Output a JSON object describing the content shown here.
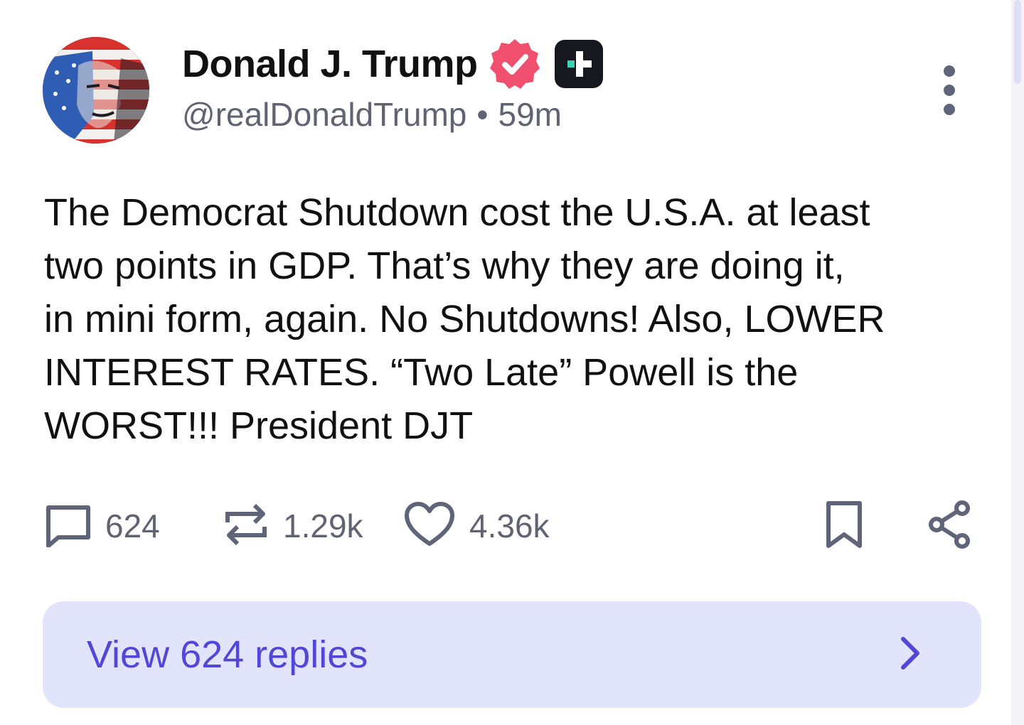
{
  "author": {
    "display_name": "Donald J. Trump",
    "handle": "@realDonaldTrump",
    "separator": "•",
    "time_ago": "59m"
  },
  "post": {
    "text": "The Democrat Shutdown cost the U.S.A. at least\ntwo points in GDP. That’s why they are doing it,\nin mini form, again. No Shutdowns! Also, LOWER\nINTEREST RATES. “Two Late” Powell is the\nWORST!!! President DJT"
  },
  "actions": {
    "replies_count": "624",
    "retruths_count": "1.29k",
    "likes_count": "4.36k"
  },
  "replies_bar": {
    "label": "View 624 replies"
  },
  "icons": {
    "verified": "verified-badge-icon",
    "plus": "plus-badge-icon",
    "more": "more-options-icon",
    "reply": "comment-icon",
    "retruth": "repost-icon",
    "like": "heart-icon",
    "bookmark": "bookmark-icon",
    "share": "share-icon",
    "chevron": "chevron-right-icon"
  },
  "colors": {
    "verified": "#f0506e",
    "accent": "#5146d6",
    "replies_bg": "#e2e4fc",
    "muted_text": "#5f6372",
    "plus_badge_bg": "#17181f",
    "plus_badge_accent": "#39d3b5"
  }
}
